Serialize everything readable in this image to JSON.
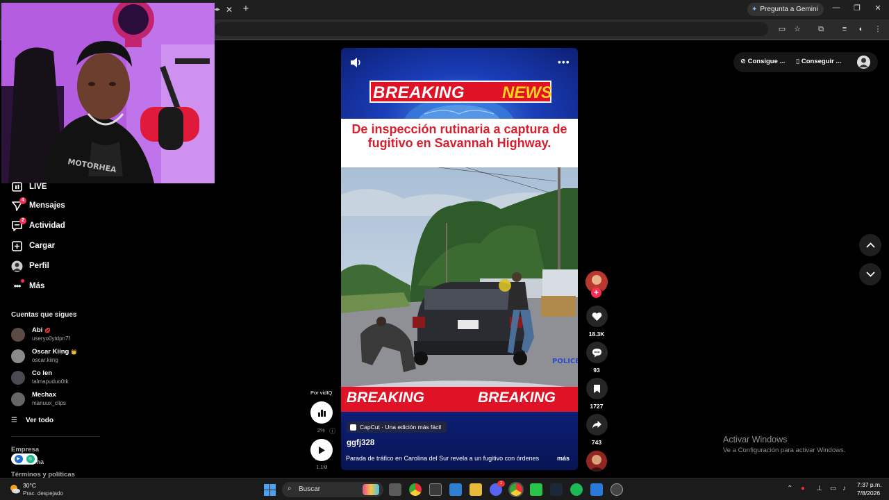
{
  "browser": {
    "tab_partial": "◂▸",
    "close_tab": "✕",
    "new_tab": "+",
    "gemini_label": "Pregunta a Gemini",
    "window_controls": [
      "—",
      "❐",
      "✕"
    ]
  },
  "sidebar": {
    "items": [
      {
        "label": "LIVE",
        "icon": "live-icon"
      },
      {
        "label": "Mensajes",
        "icon": "send-icon",
        "badge": "4"
      },
      {
        "label": "Actividad",
        "icon": "activity-icon",
        "badge": "2"
      },
      {
        "label": "Cargar",
        "icon": "upload-icon"
      },
      {
        "label": "Perfil",
        "icon": "profile-avatar"
      },
      {
        "label": "Más",
        "icon": "more-icon"
      }
    ],
    "following_title": "Cuentas que sigues",
    "following": [
      {
        "name": "Abi",
        "handle": "useryo0ytdpn7f",
        "emoji": "💋"
      },
      {
        "name": "Oscar Kiing",
        "handle": "oscar.kiing",
        "emoji": "👑"
      },
      {
        "name": "Co len",
        "handle": "talmapuduo0tk",
        "emoji": ""
      },
      {
        "name": "Mechax",
        "handle": "manuux_clips",
        "emoji": ""
      }
    ],
    "see_all": "Ver todo",
    "footer_company": "Empresa",
    "footer_partial": "ama",
    "footer_terms": "Términos y políticas"
  },
  "top_right": {
    "pill1": "Consigue ...",
    "pill2": "Conseguir ..."
  },
  "video": {
    "breaking_word": "BREAKING",
    "news_word": "NEWS",
    "headline": "De inspección rutinaria a captura de fugitivo en Savannah Highway.",
    "bar_left": "BREAKING",
    "bar_right": "BREAKING",
    "police_text": "POLICE",
    "capcut": "CapCut · Una edición más fácil",
    "author": "ggfj328",
    "description": "Parada de tráfico en Carolina del Sur revela a un fugitivo con órdenes",
    "more": "más",
    "more_dots": "•••"
  },
  "actions": {
    "likes": "18.3K",
    "comments": "93",
    "saves": "1727",
    "shares": "743"
  },
  "left_controls": {
    "by": "Por vidIQ",
    "percent": "2%",
    "views": "1.1M"
  },
  "watermark": {
    "line1": "Activar Windows",
    "line2": "Ve a Configuración para activar Windows."
  },
  "taskbar": {
    "temp": "30°C",
    "condition": "Prac. despejado",
    "search": "Buscar",
    "time": "7:37 p.m.",
    "date": "7/8/2026",
    "discord_badge": "1"
  },
  "colors": {
    "tiktok_red": "#fe2c55",
    "breaking_red": "#e01226",
    "news_yellow": "#ffd21a",
    "headline_red": "#d5202f",
    "video_blue": "#0c1f75"
  }
}
